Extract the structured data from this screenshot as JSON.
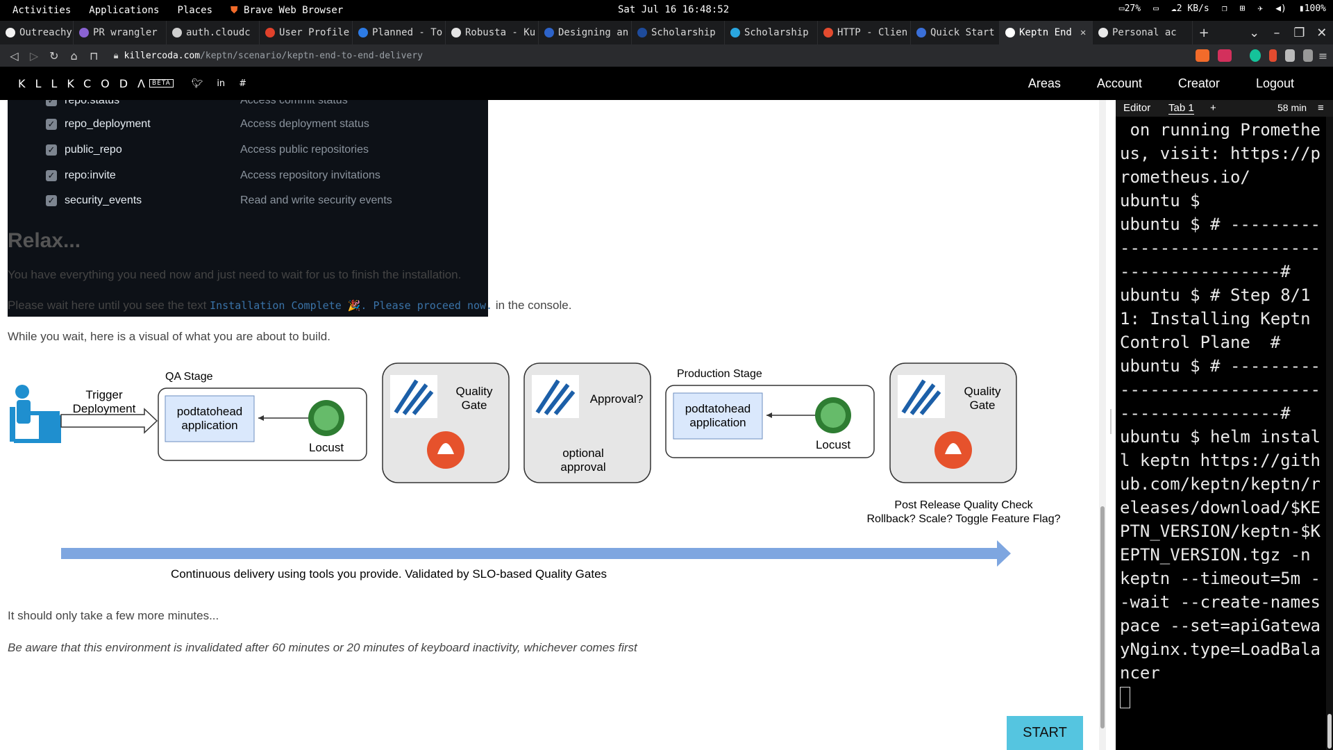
{
  "topbar": {
    "activities": "Activities",
    "applications": "Applications",
    "places": "Places",
    "app_name": "Brave Web Browser",
    "clock": "Sat Jul 16 16:48:52",
    "battery_cpu": "27%",
    "net": "2 KB/s",
    "battery": "100%"
  },
  "tabs": [
    {
      "label": "Outreachy",
      "color": "#f2f2f2",
      "active": false
    },
    {
      "label": "PR wrangler",
      "color": "#8a63d2",
      "active": false
    },
    {
      "label": "auth.cloudc",
      "color": "#cfcfcf",
      "active": false
    },
    {
      "label": "User Profile",
      "color": "#e0412b",
      "active": false
    },
    {
      "label": "Planned - To",
      "color": "#2d7be5",
      "active": false
    },
    {
      "label": "Robusta - Ku",
      "color": "#e5e5e5",
      "active": false
    },
    {
      "label": "Designing an",
      "color": "#2d63c9",
      "active": false
    },
    {
      "label": "Scholarship",
      "color": "#1e4b9b",
      "active": false
    },
    {
      "label": "Scholarship",
      "color": "#2aa6e0",
      "active": false
    },
    {
      "label": "HTTP - Clien",
      "color": "#e34b2f",
      "active": false
    },
    {
      "label": "Quick Start",
      "color": "#3a6fd8",
      "active": false
    },
    {
      "label": "Keptn End",
      "color": "#ffffff",
      "active": true
    },
    {
      "label": "Personal ac",
      "color": "#e8e8e8",
      "active": false
    }
  ],
  "address": {
    "host": "killercoda.com",
    "path": "/keptn/scenario/keptn-end-to-end-delivery"
  },
  "header": {
    "logo": "KLLKCODΛ",
    "beta": "BETA",
    "nav": [
      "Areas",
      "Account",
      "Creator",
      "Logout"
    ]
  },
  "permissions": [
    {
      "name": "repo:status",
      "desc": "Access commit status"
    },
    {
      "name": "repo_deployment",
      "desc": "Access deployment status"
    },
    {
      "name": "public_repo",
      "desc": "Access public repositories"
    },
    {
      "name": "repo:invite",
      "desc": "Access repository invitations"
    },
    {
      "name": "security_events",
      "desc": "Read and write security events"
    }
  ],
  "article": {
    "heading": "Relax...",
    "p1": "You have everything you need now and just need to wait for us to finish the installation.",
    "p2_pre": "Please wait here until you see the text",
    "p2_code": "Installation Complete 🎉. Please proceed now.",
    "p2_post": "in the console.",
    "p3": "While you wait, here is a visual of what you are about to build.",
    "p4": "It should only take a few more minutes...",
    "p5": "Be aware that this environment is invalidated after 60 minutes or 20 minutes of keyboard inactivity, whichever comes first",
    "start": "START"
  },
  "diagram": {
    "trigger": [
      "Trigger",
      "Deployment"
    ],
    "qa_stage": "QA Stage",
    "app": [
      "podtatohead",
      "application"
    ],
    "locust": "Locust",
    "quality_gate": [
      "Quality",
      "Gate"
    ],
    "approval": "Approval?",
    "optional": [
      "optional",
      "approval"
    ],
    "prod_stage": "Production Stage",
    "post_release": [
      "Post Release Quality Check",
      "Rollback? Scale? Toggle Feature Flag?"
    ],
    "caption": "Continuous delivery using tools you provide. Validated by SLO-based Quality Gates"
  },
  "terminal": {
    "editor": "Editor",
    "tab": "Tab 1",
    "timer": "58 min",
    "output": " on running Prometheus, visit: https://prometheus.io/\nubuntu $ \nubuntu $ # ---------------------------------------------#\nubuntu $ # Step 8/11: Installing Keptn Control Plane  #\nubuntu $ # ---------------------------------------------#\nubuntu $ helm install keptn https://github.com/keptn/keptn/releases/download/$KEPTN_VERSION/keptn-$KEPTN_VERSION.tgz -n keptn --timeout=5m --wait --create-namespace --set=apiGatewayNginx.type=LoadBalancer\n"
  }
}
